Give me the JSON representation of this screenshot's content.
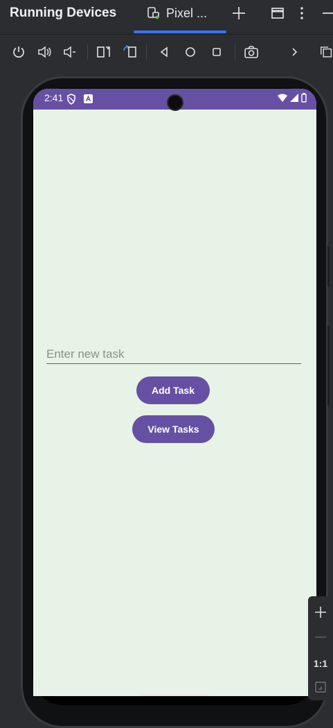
{
  "window": {
    "title": "Running Devices",
    "tab_label": "Pixel ..."
  },
  "toolbar": {
    "icons": [
      "power-icon",
      "volume-up-icon",
      "volume-down-icon",
      "rotate-left-icon",
      "rotate-right-icon",
      "back-icon",
      "home-icon",
      "overview-icon",
      "screenshot-icon",
      "more-icon",
      "fold-icon"
    ]
  },
  "device": {
    "status_time": "2:41",
    "app": {
      "input_placeholder": "Enter new task",
      "input_value": "",
      "add_button": "Add Task",
      "view_button": "View Tasks"
    }
  },
  "zoom": {
    "actual_size_label": "1:1"
  },
  "colors": {
    "ide_background": "#2b2d30",
    "accent": "#3574f0",
    "app_primary": "#6650a4",
    "app_background": "#e7f3e6"
  }
}
